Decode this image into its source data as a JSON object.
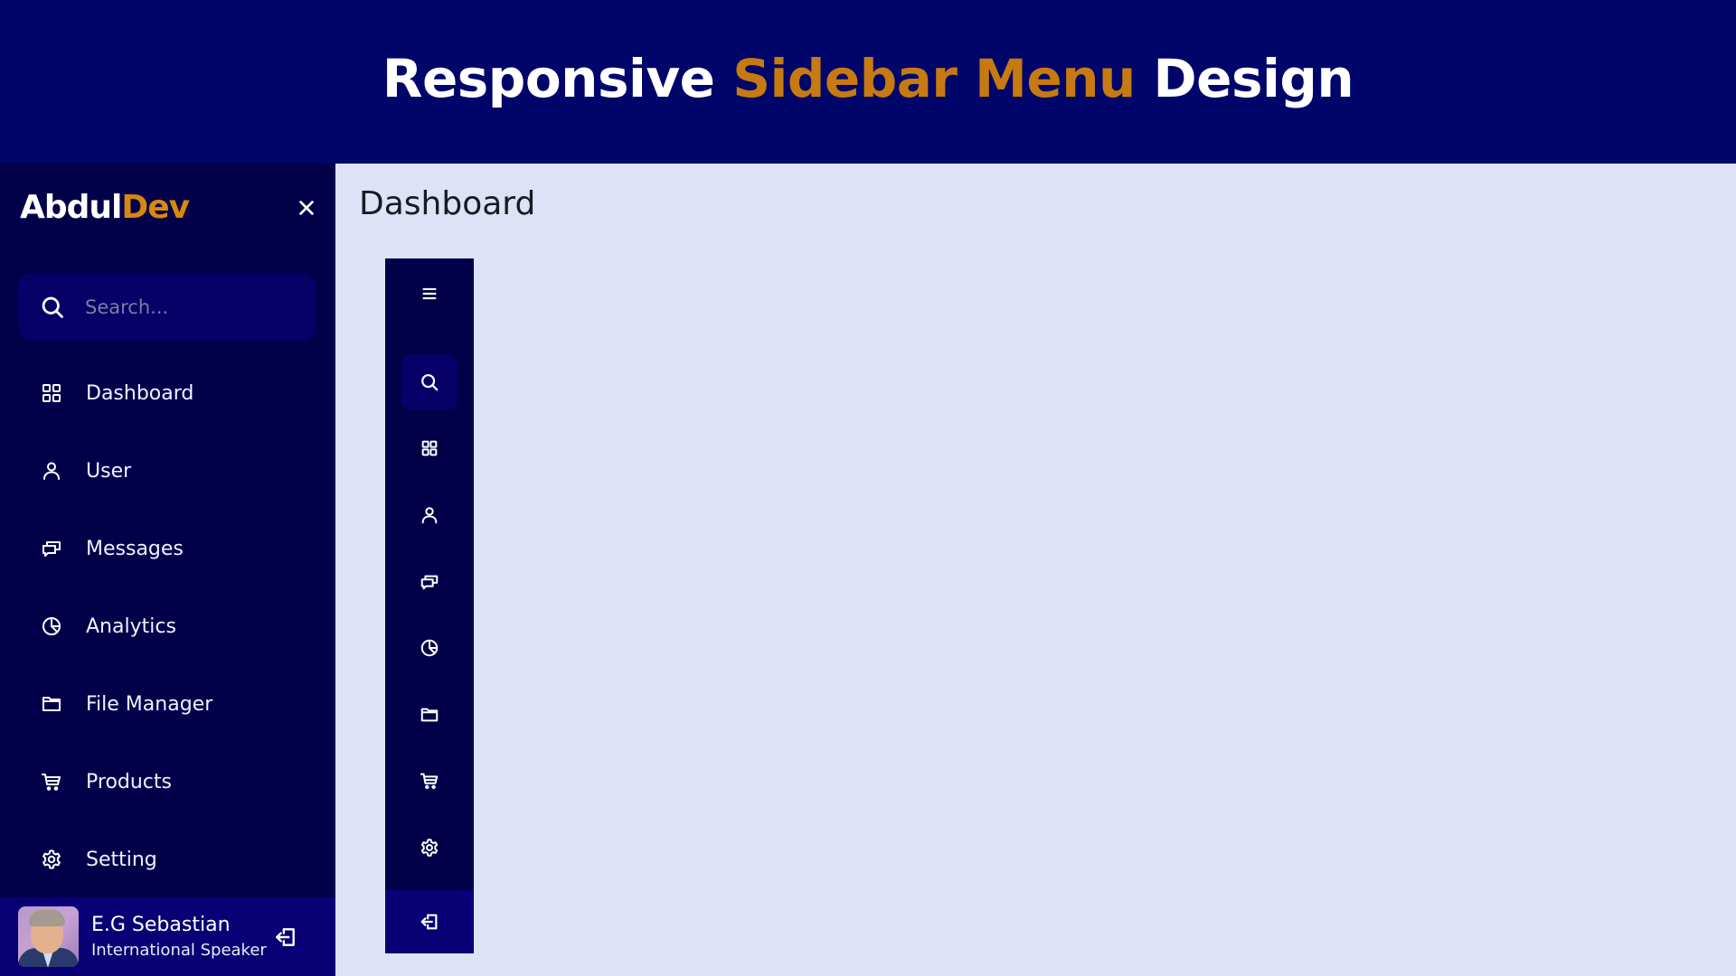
{
  "banner": {
    "title_part1": "Responsive ",
    "title_accent": "Sidebar Menu",
    "title_part2": " Design",
    "accent_color": "#c77a12"
  },
  "sidebar": {
    "logo_part1": "Abdul",
    "logo_accent": "Dev",
    "close_icon": "close-icon",
    "search": {
      "placeholder": "Search...",
      "value": "",
      "icon": "search-icon"
    },
    "items": [
      {
        "label": "Dashboard",
        "icon": "grid-icon"
      },
      {
        "label": "User",
        "icon": "user-icon"
      },
      {
        "label": "Messages",
        "icon": "messages-icon"
      },
      {
        "label": "Analytics",
        "icon": "pie-chart-icon"
      },
      {
        "label": "File Manager",
        "icon": "folder-icon"
      },
      {
        "label": "Products",
        "icon": "cart-icon"
      },
      {
        "label": "Setting",
        "icon": "gear-icon"
      }
    ],
    "profile": {
      "name": "E.G Sebastian",
      "role": "International Speaker",
      "logout_icon": "logout-icon"
    }
  },
  "main": {
    "title": "Dashboard"
  },
  "collapsed_sidebar": {
    "toggle_icon": "menu-icon",
    "icons": [
      "search-icon",
      "grid-icon",
      "user-icon",
      "messages-icon",
      "pie-chart-icon",
      "folder-icon",
      "cart-icon",
      "gear-icon"
    ],
    "logout_icon": "logout-icon"
  },
  "colors": {
    "banner_bg": "#000569",
    "sidebar_bg": "#03004a",
    "search_bg": "#060067",
    "profile_bg": "#080074",
    "main_bg": "#dde2f6",
    "logo_accent": "#d8870f"
  }
}
